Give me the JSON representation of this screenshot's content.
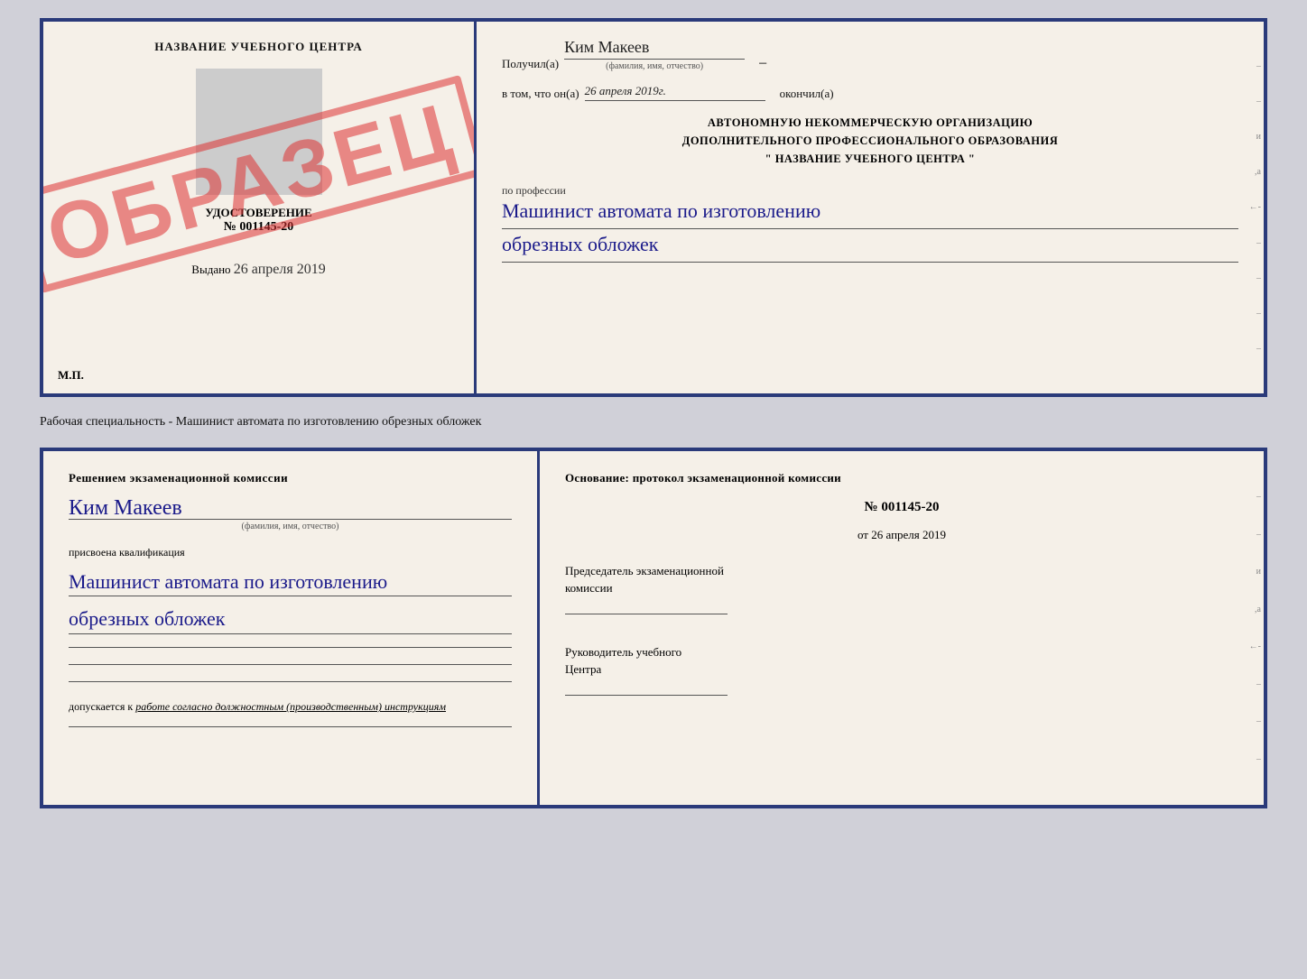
{
  "top_cert": {
    "left": {
      "title": "НАЗВАНИЕ УЧЕБНОГО ЦЕНТРА",
      "cert_label": "УДОСТОВЕРЕНИЕ",
      "cert_number_prefix": "№",
      "cert_number": "001145-20",
      "issued_prefix": "Выдано",
      "issued_date": "26 апреля 2019",
      "mp_label": "М.П.",
      "obrazec": "ОБРАЗЕЦ"
    },
    "right": {
      "received_label": "Получил(а)",
      "received_name": "Ким Макеев",
      "name_sub": "(фамилия, имя, отчество)",
      "in_that_prefix": "в том, что он(а)",
      "completion_date": "26 апреля 2019г.",
      "completion_suffix": "окончил(а)",
      "body_line1": "АВТОНОМНУЮ НЕКОММЕРЧЕСКУЮ ОРГАНИЗАЦИЮ",
      "body_line2": "ДОПОЛНИТЕЛЬНОГО ПРОФЕССИОНАЛЬНОГО ОБРАЗОВАНИЯ",
      "body_line3": "\"    НАЗВАНИЕ УЧЕБНОГО ЦЕНТРА    \"",
      "profession_prefix": "по профессии",
      "profession_line1": "Машинист автомата по изготовлению",
      "profession_line2": "обрезных обложек"
    }
  },
  "middle": {
    "text": "Рабочая специальность - Машинист автомата по изготовлению обрезных обложек"
  },
  "bottom_cert": {
    "left": {
      "title_line1": "Решением экзаменационной комиссии",
      "person_name": "Ким Макеев",
      "name_sub": "(фамилия, имя, отчество)",
      "qualification_label": "присвоена квалификация",
      "qualification_line1": "Машинист автомата по изготовлению",
      "qualification_line2": "обрезных обложек",
      "allowed_prefix": "допускается к",
      "allowed_text": "работе согласно должностным (производственным) инструкциям"
    },
    "right": {
      "basis_label": "Основание: протокол экзаменационной комиссии",
      "protocol_prefix": "№",
      "protocol_number": "001145-20",
      "date_prefix": "от",
      "date_value": "26 апреля 2019",
      "chairman_label_line1": "Председатель экзаменационной",
      "chairman_label_line2": "комиссии",
      "director_label_line1": "Руководитель учебного",
      "director_label_line2": "Центра"
    }
  }
}
